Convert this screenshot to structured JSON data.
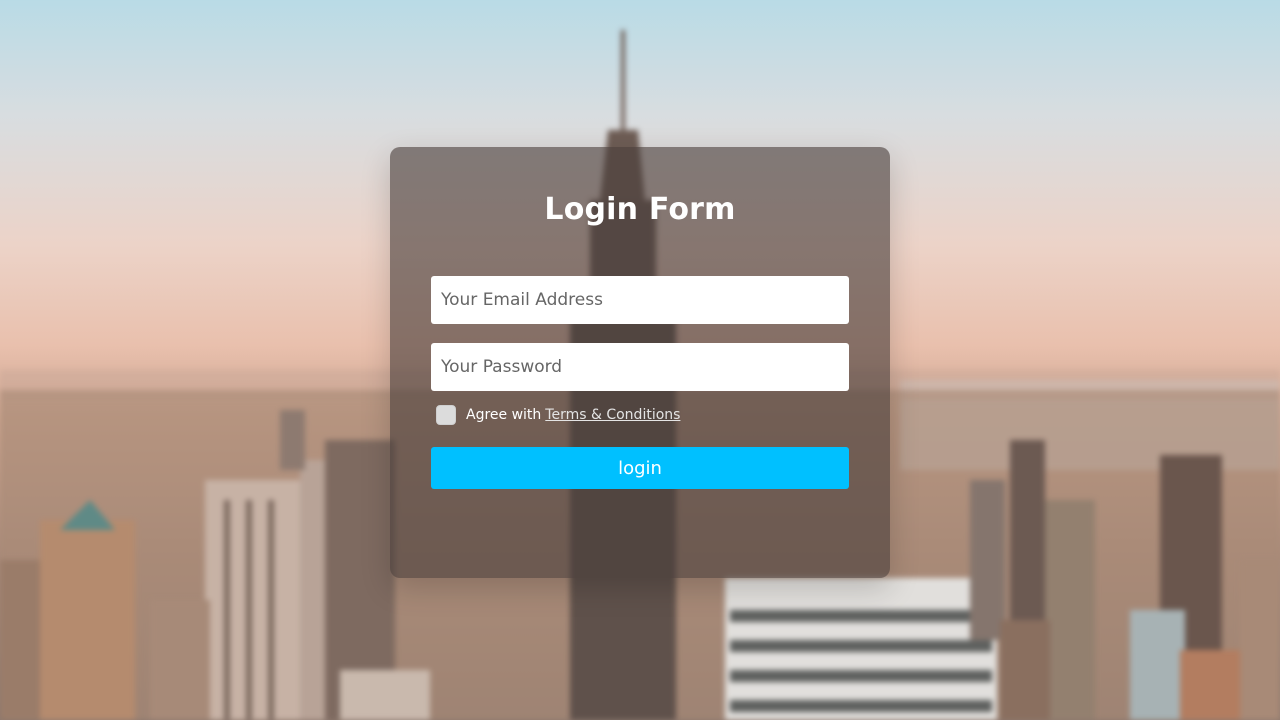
{
  "form": {
    "title": "Login Form",
    "email_placeholder": "Your Email Address",
    "password_placeholder": "Your Password",
    "agree_text": "Agree with",
    "terms_link": "Terms & Conditions",
    "agree_checked": false,
    "login_label": "login"
  },
  "colors": {
    "button": "#00c0ff",
    "card_overlay": "rgba(72,62,58,0.62)"
  }
}
